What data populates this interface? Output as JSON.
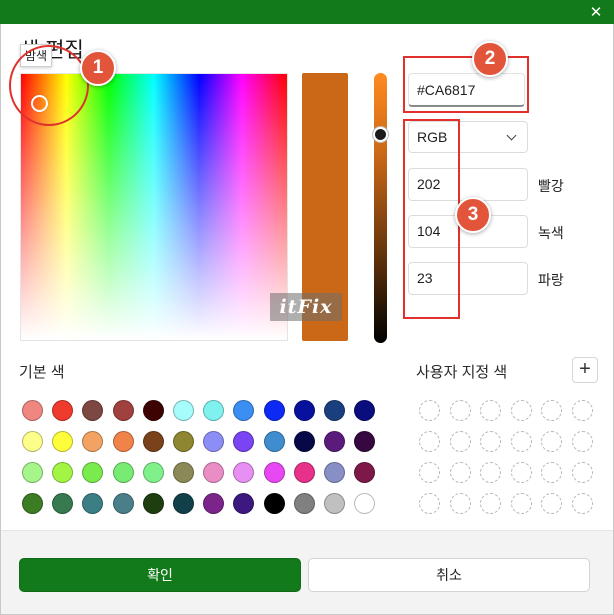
{
  "dialog": {
    "title": "색 편집",
    "tooltip": "밤색",
    "close_glyph": "✕"
  },
  "color_editor": {
    "hex_value": "#CA6817",
    "current_color": "#CA6817",
    "mode": "RGB",
    "channels": [
      {
        "label": "빨강",
        "value": "202"
      },
      {
        "label": "녹색",
        "value": "104"
      },
      {
        "label": "파랑",
        "value": "23"
      }
    ]
  },
  "annotations": {
    "badges": [
      "1",
      "2",
      "3"
    ]
  },
  "watermark": {
    "text": "itFix"
  },
  "basic_colors": {
    "label": "기본 색",
    "swatches": [
      "#ef8680",
      "#ef3a2e",
      "#7d4742",
      "#a0413f",
      "#3d0303",
      "#a6fbfb",
      "#7ff2f0",
      "#3b8ef2",
      "#0d2af5",
      "#08109e",
      "#1a3f7f",
      "#0a0d7d",
      "#fdfd8a",
      "#fdfd3c",
      "#f2a262",
      "#ef8349",
      "#7a421a",
      "#8e8631",
      "#8d8ef5",
      "#7a44f2",
      "#3f8dce",
      "#060848",
      "#5a1b7d",
      "#37083f",
      "#a5f58a",
      "#a3f545",
      "#7aeb4d",
      "#78eb72",
      "#80f08a",
      "#8b8957",
      "#ea8dc5",
      "#e88ff3",
      "#e748f3",
      "#e7318b",
      "#878fc6",
      "#7d1849",
      "#3c7c22",
      "#377a4f",
      "#3b7f85",
      "#4a7f89",
      "#1e3e10",
      "#12404a",
      "#7b248a",
      "#3d197f",
      "#000000",
      "#808080",
      "#c0c0c0",
      "#ffffff"
    ]
  },
  "custom_colors": {
    "label": "사용자 지정 색",
    "add_glyph": "+",
    "slots": 24
  },
  "buttons": {
    "ok": "확인",
    "cancel": "취소"
  }
}
